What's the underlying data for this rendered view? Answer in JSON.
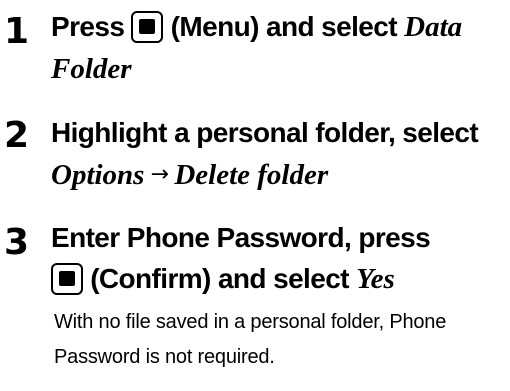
{
  "steps": [
    {
      "number": "1",
      "line1_before": "Press",
      "line1_after": "(Menu) and select",
      "line1_italic": "Data",
      "line2_italic": "Folder"
    },
    {
      "number": "2",
      "line1": "Highlight a personal folder, select",
      "line2_italic_a": "Options",
      "arrow": "→",
      "line2_italic_b": "Delete folder"
    },
    {
      "number": "3",
      "line1": "Enter Phone Password, press",
      "line2_after": "(Confirm) and select",
      "line2_italic": "Yes"
    }
  ],
  "note": "With no file saved in a personal folder, Phone Password is not required.",
  "icons": {
    "menu_key": "menu-key-icon",
    "confirm_key": "confirm-key-icon"
  }
}
